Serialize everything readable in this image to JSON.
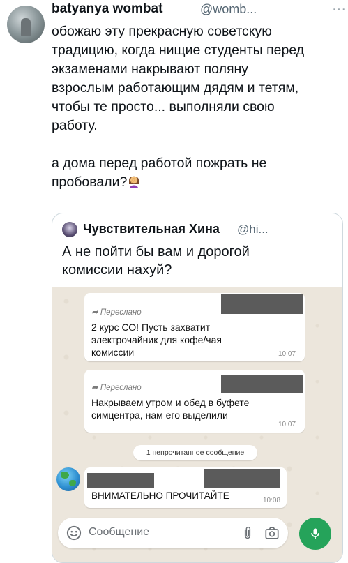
{
  "tweet": {
    "username": "batyanya wombat",
    "handle": "@womb...",
    "more_icon": "ellipsis-icon",
    "text": "обожаю эту прекрасную советскую\nтрадицию, когда нищие студенты перед\nэкзаменами накрывают поляну\nвзрослым работающим дядям и тетям,\nчтобы те просто... выполняли свою\nработу.\n\nа дома перед работой пожрать не\nпробовали?",
    "emoji": "woman-facepalming-emoji"
  },
  "quote": {
    "name": "Чувствительная Хина",
    "handle": "@hi...",
    "text": "А не пойти бы вам и дорогой\nкомиссии нахуй?"
  },
  "whatsapp": {
    "messages": [
      {
        "forwarded": "Переслано",
        "text": "2 курс СО! Пусть захватит\nэлектрочайник для кофе/чая\nкомиссии",
        "time": "10:07"
      },
      {
        "forwarded": "Переслано",
        "text": "Накрываем утром и  обед в буфете\nсимцентра, нам его выделили",
        "time": "10:07"
      }
    ],
    "unread_label": "1 непрочитанное сообщение",
    "incoming": {
      "text": "ВНИМАТЕЛЬНО ПРОЧИТАЙТЕ",
      "time": "10:08"
    },
    "input_placeholder": "Сообщение",
    "colors": {
      "background": "#ece6dc",
      "mic_button": "#25a35a",
      "redaction": "#5b5b5b"
    }
  }
}
